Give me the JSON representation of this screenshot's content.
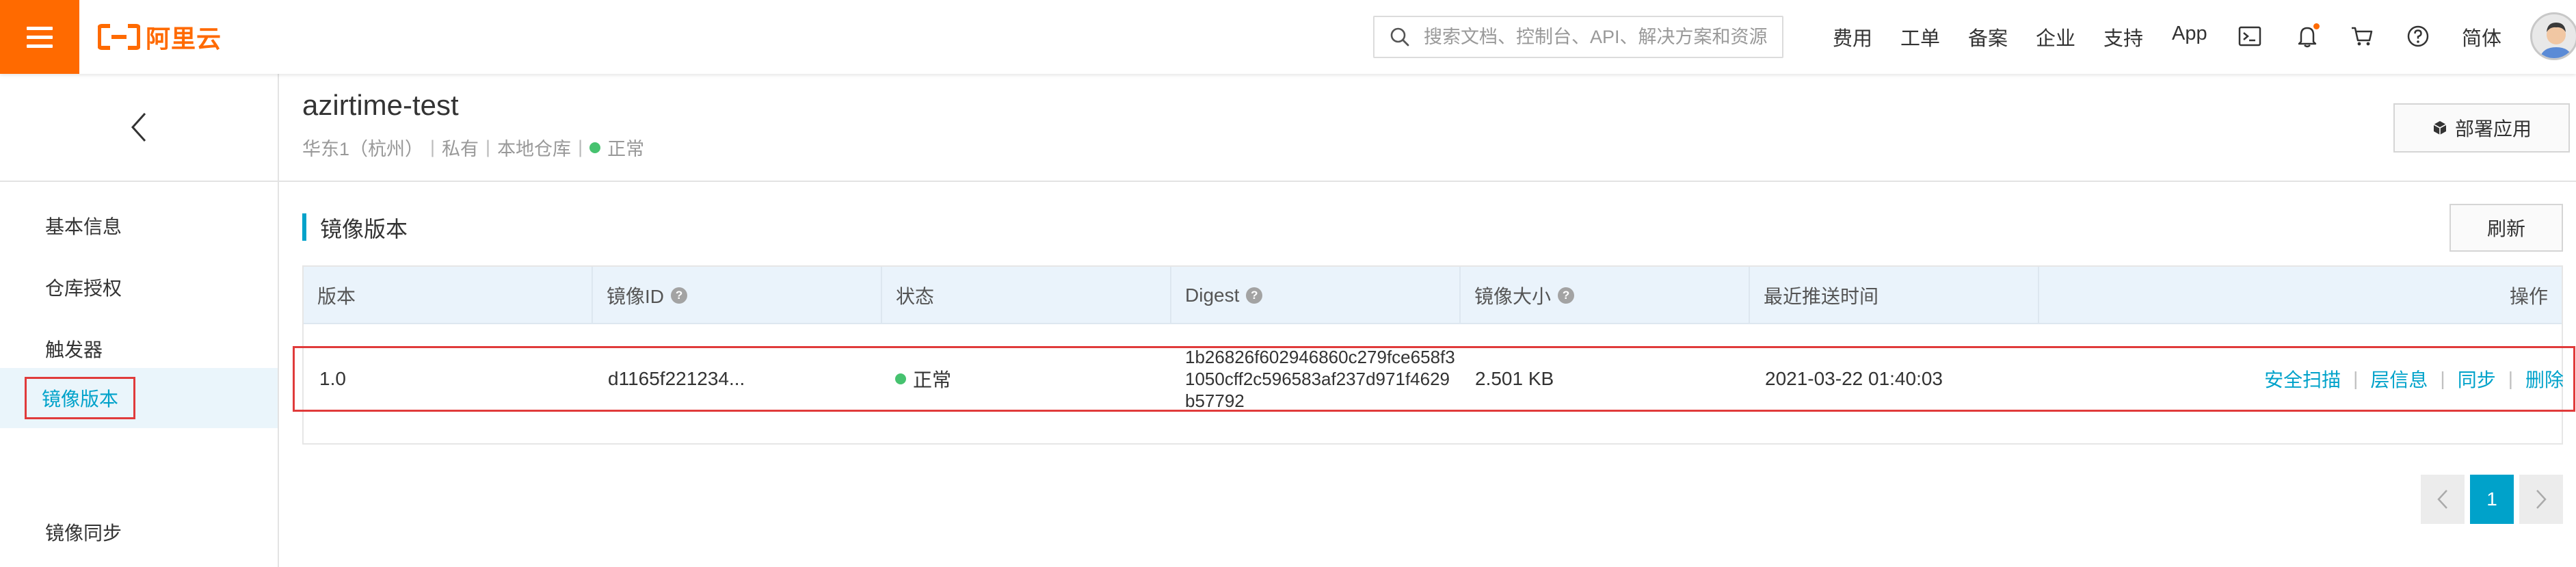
{
  "topbar": {
    "logo_text": "阿里云",
    "search_placeholder": "搜索文档、控制台、API、解决方案和资源",
    "nav": [
      "费用",
      "工单",
      "备案",
      "企业",
      "支持",
      "App"
    ],
    "lang_label": "简体",
    "brand_color": "#ff6a00",
    "icons": [
      "menu-icon",
      "search-icon",
      "terminal-icon",
      "bell-icon",
      "cart-icon",
      "help-icon"
    ]
  },
  "sidebar": {
    "back_icon": "chevron-left-icon",
    "items": [
      {
        "label": "基本信息"
      },
      {
        "label": "仓库授权"
      },
      {
        "label": "触发器"
      },
      {
        "label": "镜像版本",
        "active": true
      },
      {
        "label": "镜像同步"
      }
    ]
  },
  "repo": {
    "name": "azirtime-test",
    "region": "华东1（杭州）",
    "visibility": "私有",
    "source": "本地仓库",
    "status": "正常",
    "deploy_label": "部署应用"
  },
  "section": {
    "title": "镜像版本",
    "refresh_label": "刷新"
  },
  "table": {
    "columns": [
      "版本",
      "镜像ID",
      "状态",
      "Digest",
      "镜像大小",
      "最近推送时间",
      "操作"
    ],
    "rows": [
      {
        "version": "1.0",
        "image_id": "d1165f221234...",
        "status": "正常",
        "digest": "1b26826f602946860c279fce658f31050cff2c596583af237d971f4629b57792",
        "size": "2.501 KB",
        "pushed_at": "2021-03-22 01:40:03",
        "actions": [
          "安全扫描",
          "层信息",
          "同步",
          "删除"
        ]
      }
    ]
  },
  "pagination": {
    "current": "1",
    "prev_icon": "chevron-left-icon",
    "next_icon": "chevron-right-icon"
  },
  "colors": {
    "accent": "#00a2ca",
    "status_ok": "#46c26f",
    "highlight_border": "#e03b3b"
  }
}
